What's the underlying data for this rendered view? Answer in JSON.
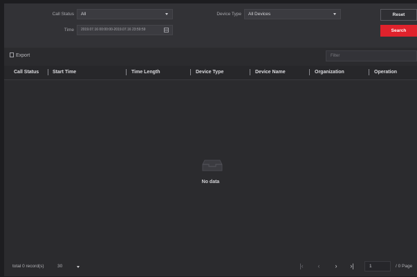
{
  "filters": {
    "call_status_label": "Call Status",
    "call_status_value": "All",
    "device_type_label": "Device Type",
    "device_type_value": "All Devices",
    "time_label": "Time",
    "time_value": "2019.07.16 00:00:00-2019.07.16 23:59:59",
    "reset_label": "Reset",
    "search_label": "Search"
  },
  "toolbar": {
    "export_label": "Export",
    "filter_placeholder": "Filter"
  },
  "table": {
    "columns": [
      "Call Status",
      "Start Time",
      "Time Length",
      "Device Type",
      "Device Name",
      "Organization",
      "Operation"
    ],
    "empty_text": "No data"
  },
  "footer": {
    "total_text": "total 0 record(s)",
    "page_size": "30",
    "page_value": "1",
    "page_total": "/ 0 Page"
  },
  "colors": {
    "accent": "#e0222c",
    "background": "#2b2b2e"
  }
}
